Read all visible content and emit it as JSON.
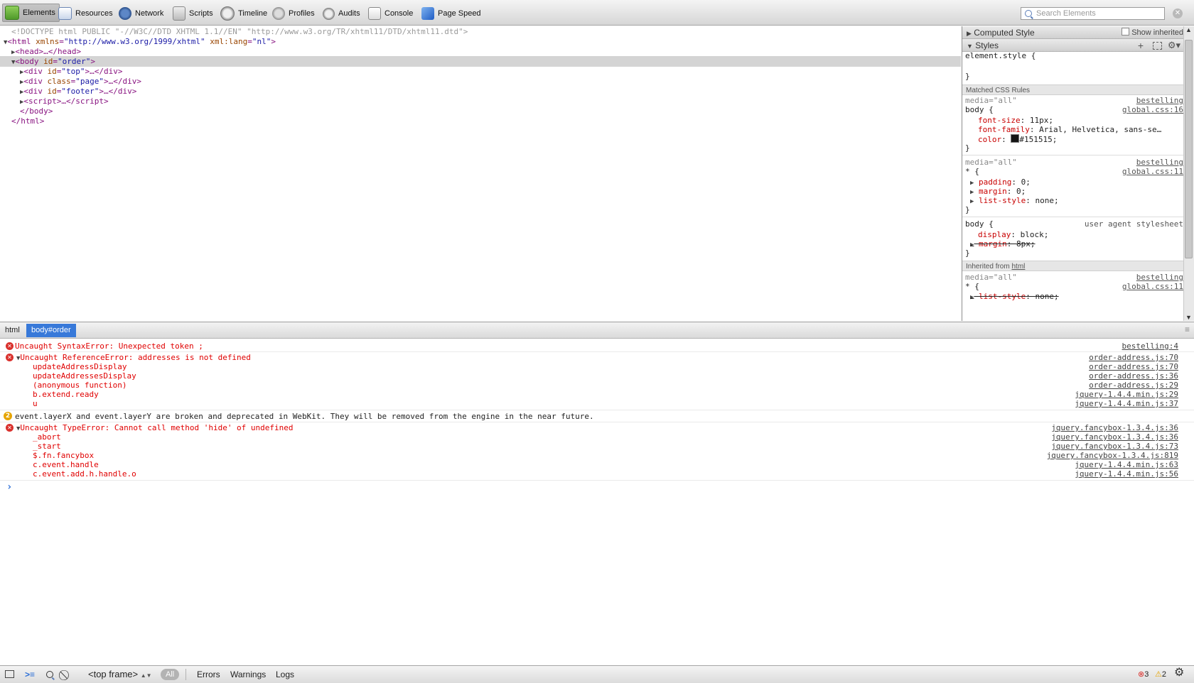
{
  "toolbar": {
    "panels": [
      {
        "label": "Elements",
        "icon": "elements-icon"
      },
      {
        "label": "Resources",
        "icon": "resources-icon"
      },
      {
        "label": "Network",
        "icon": "network-icon"
      },
      {
        "label": "Scripts",
        "icon": "scripts-icon"
      },
      {
        "label": "Timeline",
        "icon": "timeline-icon"
      },
      {
        "label": "Profiles",
        "icon": "profiles-icon"
      },
      {
        "label": "Audits",
        "icon": "audits-icon"
      },
      {
        "label": "Console",
        "icon": "console-icon"
      },
      {
        "label": "Page Speed",
        "icon": "page-speed-icon"
      }
    ],
    "selected": "Elements",
    "search_placeholder": "Search Elements"
  },
  "dom_tree": {
    "doctype": "<!DOCTYPE html PUBLIC \"-//W3C//DTD XHTML 1.1//EN\" \"http://www.w3.org/TR/xhtml11/DTD/xhtml11.dtd\">",
    "html_tag": "html",
    "html_attr1_name": "xmlns",
    "html_attr1_value": "\"http://www.w3.org/1999/xhtml\"",
    "html_attr2_name": "xml:lang",
    "html_attr2_value": "\"nl\"",
    "head": "<head>…</head>",
    "body_tag": "body",
    "body_attr_name": "id",
    "body_attr_value": "\"order\"",
    "children": [
      {
        "tag": "div",
        "attr": "id",
        "value": "\"top\""
      },
      {
        "tag": "div",
        "attr": "class",
        "value": "\"page\""
      },
      {
        "tag": "div",
        "attr": "id",
        "value": "\"footer\""
      },
      {
        "tag": "script",
        "attr": "",
        "value": ""
      }
    ],
    "body_close": "</body>",
    "html_close": "</html>"
  },
  "sidebar": {
    "computed_style_title": "Computed Style",
    "show_inherited_label": "Show inherited",
    "styles_title": "Styles",
    "element_style": "element.style {",
    "close_brace": "}",
    "matched_rules_title": "Matched CSS Rules",
    "inherited_title_prefix": "Inherited from ",
    "inherited_title_link": "html",
    "rules": [
      {
        "media": "media=\"all\"",
        "origin": "bestelling",
        "selector": "body {",
        "source": "global.css:16",
        "props": [
          {
            "name": "font-size",
            "value": "11px;"
          },
          {
            "name": "font-family",
            "value": "Arial, Helvetica, sans-se…"
          },
          {
            "name": "color",
            "value": "#151515;",
            "swatch": "#151515"
          }
        ]
      },
      {
        "media": "media=\"all\"",
        "origin": "bestelling",
        "selector": "* {",
        "source": "global.css:11",
        "props": [
          {
            "name": "padding",
            "value": "0;"
          },
          {
            "name": "margin",
            "value": "0;"
          },
          {
            "name": "list-style",
            "value": "none;"
          }
        ]
      },
      {
        "selector": "body {",
        "origin": "user agent stylesheet",
        "props": [
          {
            "name": "display",
            "value": "block;"
          },
          {
            "name": "margin",
            "value": "8px;",
            "overridden": true
          }
        ]
      },
      {
        "media": "media=\"all\"",
        "origin": "bestelling",
        "selector": "* {",
        "source": "global.css:11",
        "props": [
          {
            "name": "list-style",
            "value": "none;",
            "overridden": true
          }
        ]
      }
    ]
  },
  "breadcrumb": [
    {
      "label": "html"
    },
    {
      "label": "body#order",
      "selected": true
    }
  ],
  "console": {
    "messages": [
      {
        "level": "error",
        "text": "Uncaught SyntaxError: Unexpected token ;",
        "source": "bestelling:4"
      },
      {
        "level": "error",
        "text": "Uncaught ReferenceError: addresses is not defined",
        "source": "order-address.js:70",
        "stack": [
          {
            "fn": "updateAddressDisplay",
            "source": "order-address.js:70"
          },
          {
            "fn": "updateAddressesDisplay",
            "source": "order-address.js:36"
          },
          {
            "fn": "(anonymous function)",
            "source": "order-address.js:29"
          },
          {
            "fn": "b.extend.ready",
            "source": "jquery-1.4.4.min.js:29"
          },
          {
            "fn": "u",
            "source": "jquery-1.4.4.min.js:37"
          }
        ]
      },
      {
        "level": "warning",
        "count": "2",
        "text": "event.layerX and event.layerY are broken and deprecated in WebKit. They will be removed from the engine in the near future."
      },
      {
        "level": "error",
        "text": "Uncaught TypeError: Cannot call method 'hide' of undefined",
        "source": "jquery.fancybox-1.3.4.js:36",
        "stack": [
          {
            "fn": "_abort",
            "source": "jquery.fancybox-1.3.4.js:36"
          },
          {
            "fn": "_start",
            "source": "jquery.fancybox-1.3.4.js:73"
          },
          {
            "fn": "$.fn.fancybox",
            "source": "jquery.fancybox-1.3.4.js:819"
          },
          {
            "fn": "c.event.handle",
            "source": "jquery-1.4.4.min.js:63"
          },
          {
            "fn": "c.event.add.h.handle.o",
            "source": "jquery-1.4.4.min.js:56"
          }
        ]
      }
    ],
    "prompt": "›"
  },
  "statusbar": {
    "frame_select": "<top frame>",
    "filter_all": "All",
    "filter_errors": "Errors",
    "filter_warnings": "Warnings",
    "filter_logs": "Logs",
    "error_count": "3",
    "warning_count": "2"
  },
  "colors": {
    "accent": "#3879d9",
    "error": "#e00000",
    "tag": "#881280",
    "attr": "#994500",
    "value": "#1a1aa6"
  }
}
